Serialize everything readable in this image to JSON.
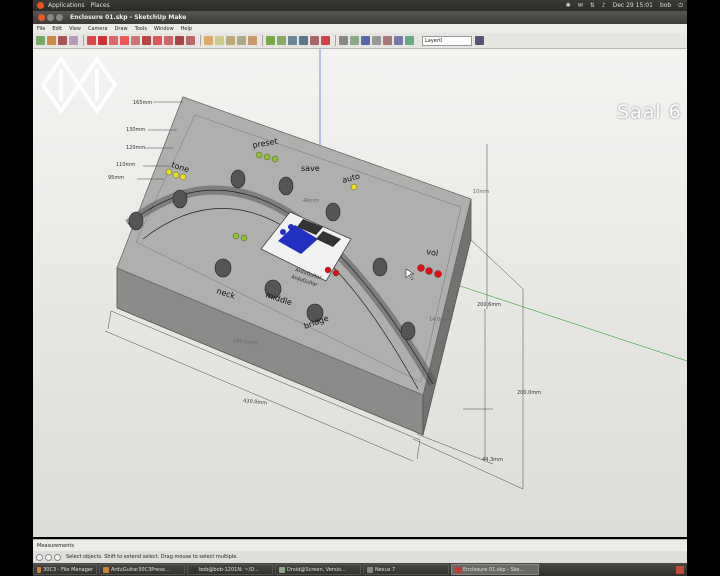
{
  "system_panel": {
    "menus": [
      "Applications",
      "Places"
    ],
    "clock": "Dec 29 15:01",
    "user": "bob"
  },
  "window": {
    "title": "Enclosure 01.skp - SketchUp Make"
  },
  "menubar": {
    "items": [
      "File",
      "Edit",
      "View",
      "Camera",
      "Draw",
      "Tools",
      "Window",
      "Help"
    ]
  },
  "toolbar": {
    "layer": "Layer0"
  },
  "model": {
    "labels": {
      "tone": "tone",
      "preset": "preset",
      "save": "save",
      "auto": "auto",
      "vol": "vol",
      "neck": "neck",
      "middle": "middle",
      "bridge": "bridge",
      "board1": "ArduGuitar",
      "board2": "ArduGuitar"
    },
    "dims": {
      "d165": "165mm",
      "d130": "130mm",
      "d120": "120mm",
      "d110": "110mm",
      "d95": "95mm",
      "d430": "430.0mm",
      "d200": "200.0mm",
      "d443": "44.3mm",
      "d2006": "200.6mm",
      "d190": "190.0mm",
      "d10": "10mm",
      "d14": "14.0mm",
      "d40": "40mm"
    },
    "colors": {
      "red_led": "#e01010",
      "yellow_led": "#e8e020",
      "green_led": "#90c030",
      "blue_comp": "#2030c0",
      "axis_green": "#30a030",
      "axis_blue": "#3050d0"
    }
  },
  "watermark": {
    "label": "Saal 6"
  },
  "measurements": {
    "label": "Measurements"
  },
  "statusbar": {
    "text": "Select objects. Shift to extend select. Drag mouse to select multiple."
  },
  "taskbar": {
    "items": [
      "30C3 - File Manager",
      "ArduGuitar30C3Prese...",
      "bob@bob-1201N: ~/D...",
      "Droid@Screen, Versio...",
      "Nexus 7",
      "Enclosure 01.skp - Ske..."
    ]
  }
}
